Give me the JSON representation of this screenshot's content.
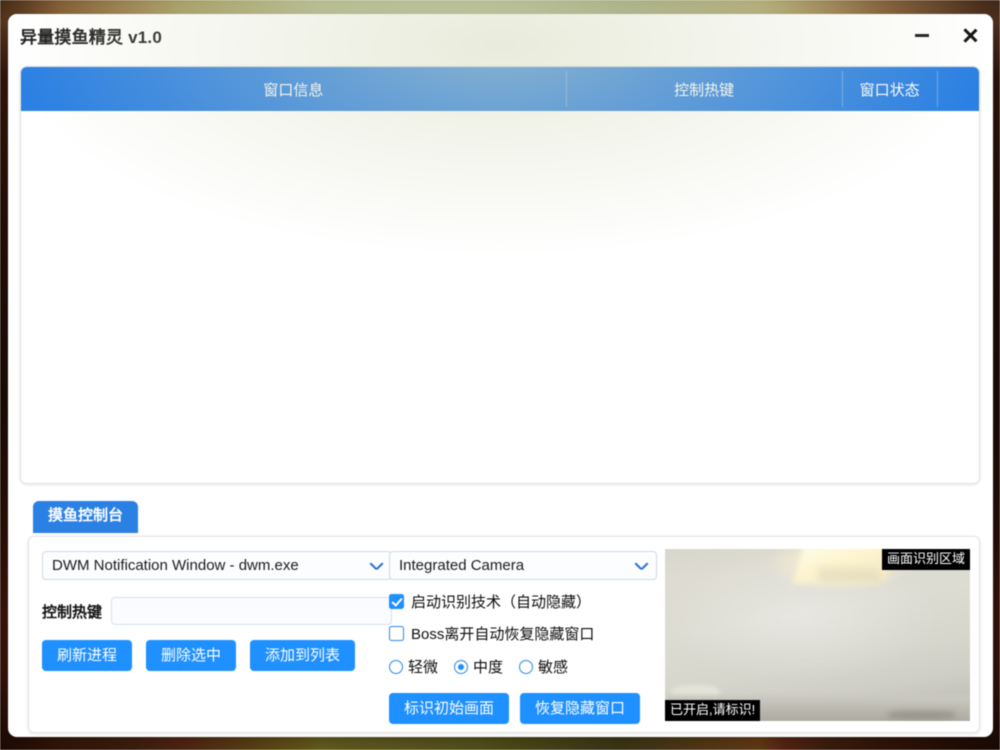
{
  "window": {
    "title": "异量摸鱼精灵 v1.0",
    "minimize_icon": "minimize-icon",
    "close_icon": "close-icon",
    "accent_blue": "#2b80e3",
    "button_blue": "#1e90ff"
  },
  "list_panel": {
    "columns": [
      "窗口信息",
      "控制热键",
      "窗口状态",
      ""
    ],
    "rows": []
  },
  "tabs": [
    {
      "label": "摸鱼控制台",
      "active": true
    }
  ],
  "console": {
    "process_select": {
      "value": "DWM Notification Window - dwm.exe",
      "icon": "chevron-down-icon"
    },
    "camera_select": {
      "value": "Integrated Camera",
      "icon": "chevron-down-icon"
    },
    "hotkey": {
      "label": "控制热键",
      "value": "",
      "placeholder": ""
    },
    "buttons": {
      "refresh": "刷新进程",
      "delete": "删除选中",
      "add": "添加到列表",
      "mark_initial": "标识初始画面",
      "restore_hidden": "恢复隐藏窗口"
    },
    "checkboxes": [
      {
        "label": "启动识别技术（自动隐藏）",
        "checked": true
      },
      {
        "label": "Boss离开自动恢复隐藏窗口",
        "checked": false
      }
    ],
    "sensitivity": {
      "options": [
        {
          "label": "轻微",
          "selected": false
        },
        {
          "label": "中度",
          "selected": true
        },
        {
          "label": "敏感",
          "selected": false
        }
      ]
    },
    "camera_preview": {
      "region_label": "画面识别区域",
      "status_label": "已开启,请标识!"
    }
  }
}
